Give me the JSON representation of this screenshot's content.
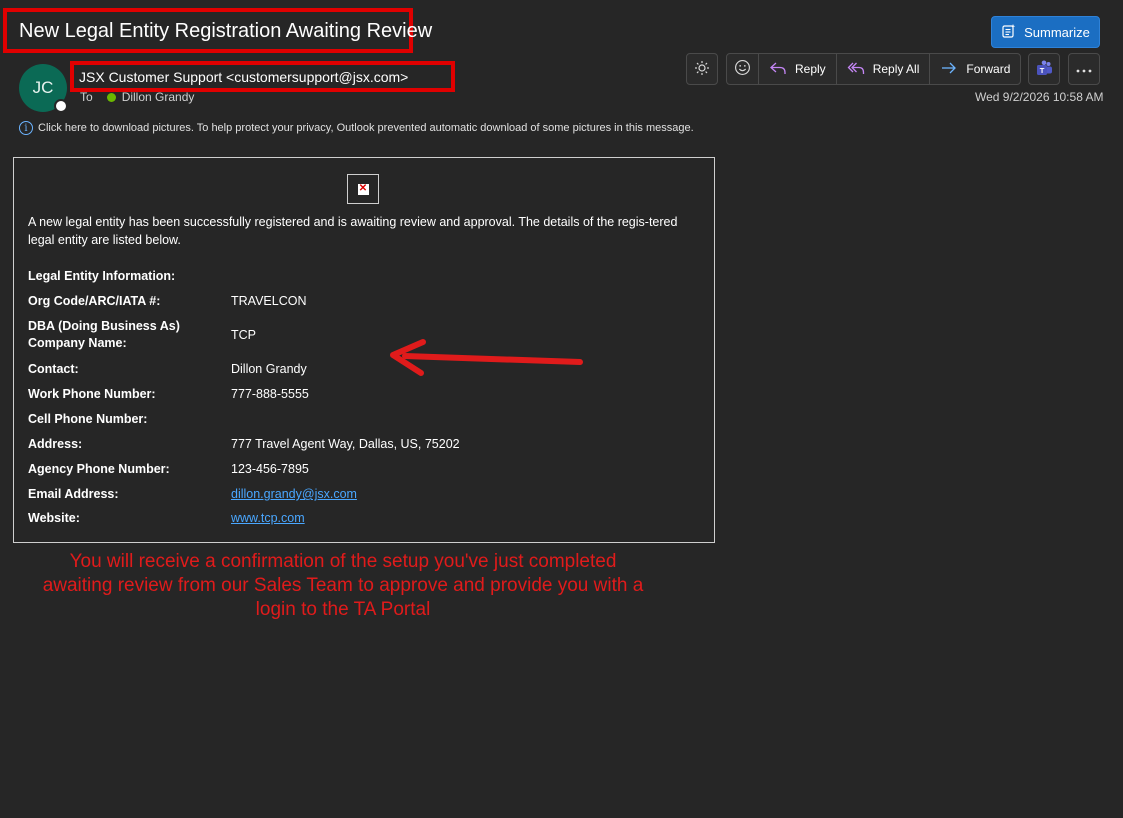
{
  "message": {
    "subject": "New Legal Entity Registration Awaiting Review",
    "avatar_initials": "JC",
    "sender": "JSX Customer Support <customersupport@jsx.com>",
    "to_label": "To",
    "recipient": "Dillon Grandy",
    "date": "Wed 9/2/2026 10:58 AM",
    "info_bar": "Click here to download pictures. To help protect your privacy, Outlook prevented automatic download of some pictures in this message."
  },
  "toolbar": {
    "summarize_label": "Summarize",
    "reply_label": "Reply",
    "reply_all_label": "Reply All",
    "forward_label": "Forward"
  },
  "body": {
    "intro": "A new legal entity has been successfully registered and is awaiting review and approval. The details of the regis-tered legal entity are listed below.",
    "section_title": "Legal Entity Information:",
    "fields": [
      {
        "label": "Org Code/ARC/IATA #:",
        "value": "TRAVELCON"
      },
      {
        "label": "DBA (Doing Business As) Company Name:",
        "label_line1": "DBA (Doing Business As)",
        "label_line2": "Company Name:",
        "value": "TCP"
      },
      {
        "label": "Contact:",
        "value": "Dillon Grandy"
      },
      {
        "label": "Work Phone Number:",
        "value": "777-888-5555"
      },
      {
        "label": "Cell Phone Number:",
        "value": ""
      },
      {
        "label": "Address:",
        "value": "777 Travel Agent Way, Dallas, US, 75202"
      },
      {
        "label": "Agency Phone Number:",
        "value": "123-456-7895"
      },
      {
        "label": "Email Address:",
        "value": "dillon.grandy@jsx.com"
      },
      {
        "label": "Website:",
        "value": "www.tcp.com"
      }
    ]
  },
  "annotation": {
    "text": "You will receive a confirmation of the setup you've just completed awaiting review from our Sales Team to approve and provide you with a login to the TA Portal",
    "color": "#e01b1b"
  },
  "colors": {
    "background": "#262626",
    "highlight_box": "#e00000",
    "summarize_button": "#1b6ec2",
    "link": "#4aa7ff",
    "avatar": "#0b6a55"
  }
}
